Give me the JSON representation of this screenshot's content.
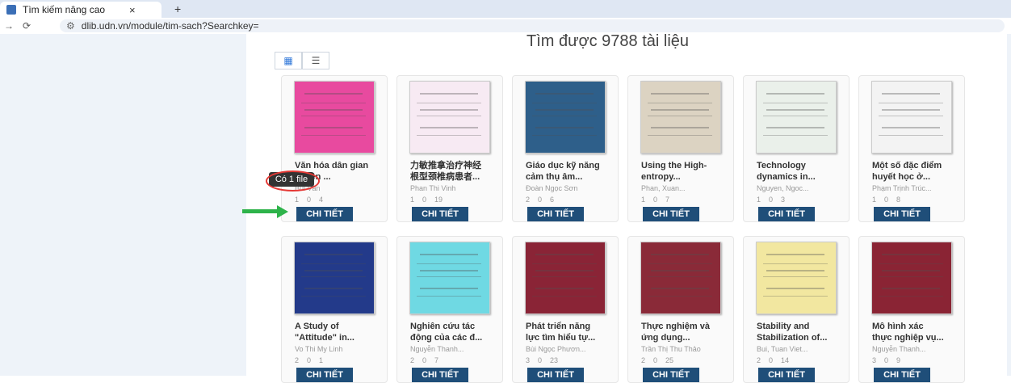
{
  "browser": {
    "tab_title": "Tìm kiếm nâng cao",
    "tab_close": "×",
    "new_tab": "+",
    "url": "dlib.udn.vn/module/tim-sach?Searchkey="
  },
  "results": {
    "title": "Tìm được 9788 tài liệu",
    "tooltip": "Có 1 file"
  },
  "books": [
    {
      "title1": "Văn hóa dân gian",
      "title2": "...Trên ...",
      "author": "Bùi Văn",
      "views": "1",
      "downloads": "0",
      "files": "4",
      "cover_color": "#e84a9f",
      "button": "CHI TIẾT"
    },
    {
      "title1": "力敏推拿治疗神经",
      "title2": "根型颈椎病患者...",
      "author": "Phan Thi Vinh",
      "views": "1",
      "downloads": "0",
      "files": "19",
      "cover_color": "#f7eaf3",
      "button": "CHI TIẾT"
    },
    {
      "title1": "Giáo dục kỹ năng",
      "title2": "cảm thụ âm...",
      "author": "Đoàn Ngọc Sơn",
      "views": "2",
      "downloads": "0",
      "files": "6",
      "cover_color": "#2e5f8a",
      "button": "CHI TIẾT"
    },
    {
      "title1": "Using the High-",
      "title2": "entropy...",
      "author": "Phan, Xuan...",
      "views": "1",
      "downloads": "0",
      "files": "7",
      "cover_color": "#dcd3c2",
      "button": "CHI TIẾT"
    },
    {
      "title1": "Technology",
      "title2": "dynamics in...",
      "author": "Nguyen, Ngoc...",
      "views": "1",
      "downloads": "0",
      "files": "3",
      "cover_color": "#eaf0ea",
      "button": "CHI TIẾT"
    },
    {
      "title1": "Một số đặc điểm",
      "title2": "huyết học ở...",
      "author": "Phạm Trịnh Trúc...",
      "views": "1",
      "downloads": "0",
      "files": "8",
      "cover_color": "#f3f3f3",
      "button": "CHI TIẾT"
    },
    {
      "title1": "A Study of",
      "title2": "\"Attitude\" in...",
      "author": "Vo Thi My Linh",
      "views": "2",
      "downloads": "0",
      "files": "1",
      "cover_color": "#233a8a",
      "button": "CHI TIẾT"
    },
    {
      "title1": "Nghiên cứu tác",
      "title2": "động của các đ...",
      "author": "Nguyễn Thanh...",
      "views": "2",
      "downloads": "0",
      "files": "7",
      "cover_color": "#6fd9e3",
      "button": "CHI TIẾT"
    },
    {
      "title1": "Phát triển năng",
      "title2": "lực tìm hiểu tự...",
      "author": "Bùi Ngọc Phươn...",
      "views": "3",
      "downloads": "0",
      "files": "23",
      "cover_color": "#8a2436",
      "button": "CHI TIẾT"
    },
    {
      "title1": "Thực nghiệm và",
      "title2": "ứng dụng...",
      "author": "Trần Thị Thu Thảo",
      "views": "2",
      "downloads": "0",
      "files": "25",
      "cover_color": "#8a2a38",
      "button": "CHI TIẾT"
    },
    {
      "title1": "Stability and",
      "title2": "Stabilization of...",
      "author": "Bui, Tuan Viet...",
      "views": "2",
      "downloads": "0",
      "files": "14",
      "cover_color": "#f2e7a0",
      "button": "CHI TIẾT"
    },
    {
      "title1": "Mô hình xác",
      "title2": "thực nghiệp vụ...",
      "author": "Nguyễn Thanh...",
      "views": "3",
      "downloads": "0",
      "files": "9",
      "cover_color": "#8a2434",
      "button": "CHI TIẾT"
    }
  ]
}
